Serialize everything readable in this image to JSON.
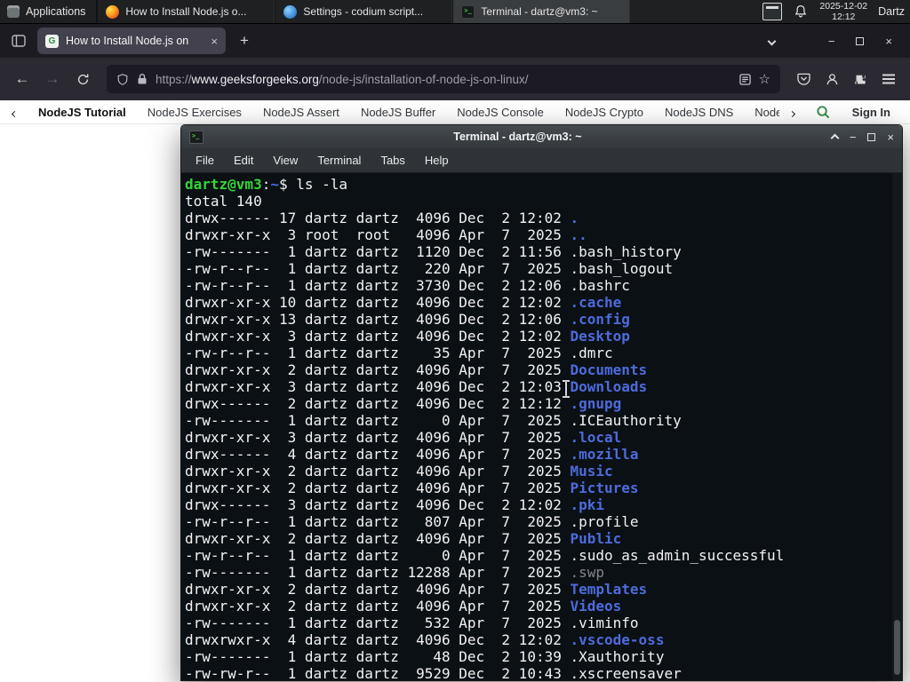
{
  "colors": {
    "term-bg": "#0b1015",
    "term-fg": "#f2f2f2",
    "prompt-green": "#35d435",
    "dir-blue": "#4d6bdb",
    "gfg-green": "#2f8d46"
  },
  "glyphs": {
    "back": "←",
    "forward": "→",
    "new_tab": "+",
    "minimize": "−",
    "close": "×",
    "star": "☆",
    "favicon_letter": "G"
  },
  "panel": {
    "applications_label": "Applications",
    "tasks": [
      {
        "title": "How to Install Node.js o...",
        "icon": "firefox",
        "active": false
      },
      {
        "title": "Settings - codium script...",
        "icon": "settings",
        "active": false
      },
      {
        "title": "Terminal - dartz@vm3: ~",
        "icon": "terminal",
        "active": true
      }
    ],
    "clock_date": "2025-12-02",
    "clock_time": "12:12",
    "user_label": "Dartz"
  },
  "browser": {
    "tab_title": "How to Install Node.js on",
    "url_scheme": "https://",
    "url_host": "www.geeksforgeeks.org",
    "url_path": "/node-js/installation-of-node-js-on-linux/",
    "nav_items": [
      "NodeJS Tutorial",
      "NodeJS Exercises",
      "NodeJS Assert",
      "NodeJS Buffer",
      "NodeJS Console",
      "NodeJS Crypto",
      "NodeJS DNS",
      "Node"
    ],
    "sign_in_label": "Sign In"
  },
  "terminal_window": {
    "title": "Terminal - dartz@vm3: ~",
    "menu_items": [
      "File",
      "Edit",
      "View",
      "Terminal",
      "Tabs",
      "Help"
    ],
    "prompt_user_host": "dartz@vm3",
    "prompt_separator": ":",
    "prompt_path": "~",
    "prompt_symbol": "$ ",
    "command": "ls -la",
    "total_line": "total 140",
    "listing": [
      {
        "meta": "drwx------ 17 dartz dartz  4096 Dec  2 12:02 ",
        "name": ".",
        "type": "dir"
      },
      {
        "meta": "drwxr-xr-x  3 root  root   4096 Apr  7  2025 ",
        "name": "..",
        "type": "dir"
      },
      {
        "meta": "-rw-------  1 dartz dartz  1120 Dec  2 11:56 ",
        "name": ".bash_history",
        "type": "file"
      },
      {
        "meta": "-rw-r--r--  1 dartz dartz   220 Apr  7  2025 ",
        "name": ".bash_logout",
        "type": "file"
      },
      {
        "meta": "-rw-r--r--  1 dartz dartz  3730 Dec  2 12:06 ",
        "name": ".bashrc",
        "type": "file"
      },
      {
        "meta": "drwxr-xr-x 10 dartz dartz  4096 Dec  2 12:02 ",
        "name": ".cache",
        "type": "dir"
      },
      {
        "meta": "drwxr-xr-x 13 dartz dartz  4096 Dec  2 12:06 ",
        "name": ".config",
        "type": "dir"
      },
      {
        "meta": "drwxr-xr-x  3 dartz dartz  4096 Dec  2 12:02 ",
        "name": "Desktop",
        "type": "dir"
      },
      {
        "meta": "-rw-r--r--  1 dartz dartz    35 Apr  7  2025 ",
        "name": ".dmrc",
        "type": "file"
      },
      {
        "meta": "drwxr-xr-x  2 dartz dartz  4096 Apr  7  2025 ",
        "name": "Documents",
        "type": "dir"
      },
      {
        "meta": "drwxr-xr-x  3 dartz dartz  4096 Dec  2 12:03 ",
        "name": "Downloads",
        "type": "dir"
      },
      {
        "meta": "drwx------  2 dartz dartz  4096 Dec  2 12:12 ",
        "name": ".gnupg",
        "type": "dir"
      },
      {
        "meta": "-rw-------  1 dartz dartz     0 Apr  7  2025 ",
        "name": ".ICEauthority",
        "type": "file"
      },
      {
        "meta": "drwxr-xr-x  3 dartz dartz  4096 Apr  7  2025 ",
        "name": ".local",
        "type": "dir"
      },
      {
        "meta": "drwx------  4 dartz dartz  4096 Apr  7  2025 ",
        "name": ".mozilla",
        "type": "dir"
      },
      {
        "meta": "drwxr-xr-x  2 dartz dartz  4096 Apr  7  2025 ",
        "name": "Music",
        "type": "dir"
      },
      {
        "meta": "drwxr-xr-x  2 dartz dartz  4096 Apr  7  2025 ",
        "name": "Pictures",
        "type": "dir"
      },
      {
        "meta": "drwx------  3 dartz dartz  4096 Dec  2 12:02 ",
        "name": ".pki",
        "type": "dir"
      },
      {
        "meta": "-rw-r--r--  1 dartz dartz   807 Apr  7  2025 ",
        "name": ".profile",
        "type": "file"
      },
      {
        "meta": "drwxr-xr-x  2 dartz dartz  4096 Apr  7  2025 ",
        "name": "Public",
        "type": "dir"
      },
      {
        "meta": "-rw-r--r--  1 dartz dartz     0 Apr  7  2025 ",
        "name": ".sudo_as_admin_successful",
        "type": "file"
      },
      {
        "meta": "-rw-------  1 dartz dartz 12288 Apr  7  2025 ",
        "name": ".swp",
        "type": "dim"
      },
      {
        "meta": "drwxr-xr-x  2 dartz dartz  4096 Apr  7  2025 ",
        "name": "Templates",
        "type": "dir"
      },
      {
        "meta": "drwxr-xr-x  2 dartz dartz  4096 Apr  7  2025 ",
        "name": "Videos",
        "type": "dir"
      },
      {
        "meta": "-rw-------  1 dartz dartz   532 Apr  7  2025 ",
        "name": ".viminfo",
        "type": "file"
      },
      {
        "meta": "drwxrwxr-x  4 dartz dartz  4096 Dec  2 12:02 ",
        "name": ".vscode-oss",
        "type": "dir"
      },
      {
        "meta": "-rw-------  1 dartz dartz    48 Dec  2 10:39 ",
        "name": ".Xauthority",
        "type": "file"
      },
      {
        "meta": "-rw-rw-r--  1 dartz dartz  9529 Dec  2 10:43 ",
        "name": ".xscreensaver",
        "type": "file"
      }
    ]
  }
}
